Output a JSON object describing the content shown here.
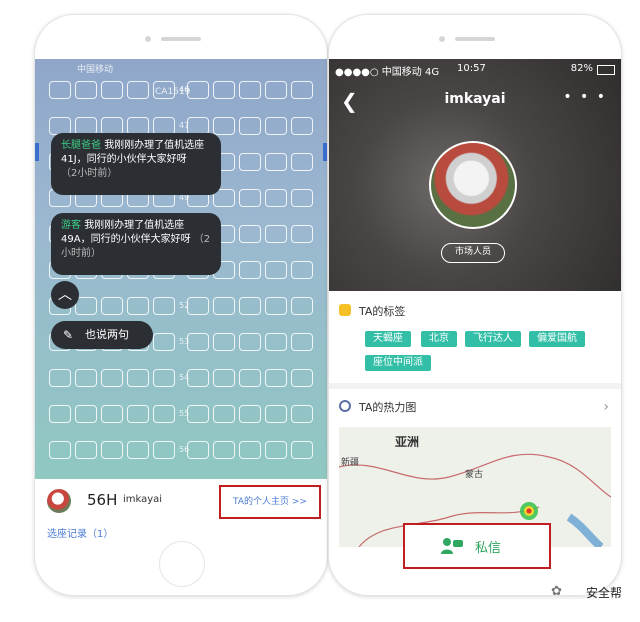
{
  "left": {
    "status_carrier": "中国移动",
    "flight_info": "CA1519",
    "row_numbers": [
      "46",
      "47",
      "48",
      "49",
      "50",
      "51",
      "52",
      "53",
      "54",
      "55",
      "56"
    ],
    "messages": [
      {
        "nick": "长腿爸爸",
        "text": "我刚刚办理了值机选座41J，同行的小伙伴大家好呀",
        "time": "（2小时前）"
      },
      {
        "nick": "游客",
        "text": "我刚刚办理了值机选座49A，同行的小伙伴大家好呀",
        "time": "（2小时前）"
      }
    ],
    "up_icon": "chevron-up-icon",
    "say_button": "也说两句",
    "seat_number": "56H",
    "username": "imkayai",
    "home_link": "TA的个人主页 >>",
    "record": "选座记录（1）"
  },
  "right": {
    "status": {
      "carrier": "●●●●○ 中国移动  4G",
      "time": "10:57",
      "battery": "82%"
    },
    "title": "imkayai",
    "more": "• • •",
    "role": "市场人员",
    "tags_title": "TA的标签",
    "tags": [
      "天蝎座",
      "北京",
      "飞行达人",
      "偏爱国航",
      "座位中间派"
    ],
    "heat_title": "TA的热力图",
    "map_labels": {
      "asia": "亚洲",
      "mongolia": "蒙古",
      "xinjiang": "新疆"
    },
    "pm_label": "私信"
  },
  "watermark": "安全帮",
  "colors": {
    "tag": "#33bfa7",
    "highlight": "#c11f1f",
    "pm": "#2fa760",
    "bubble": "#2b2e33"
  }
}
